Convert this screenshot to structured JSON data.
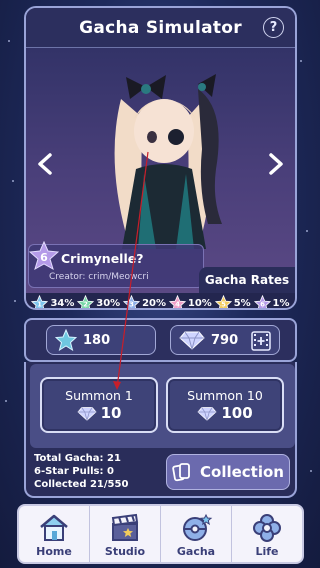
{
  "header": {
    "title": "Gacha Simulator",
    "help_label": "?"
  },
  "character": {
    "name": "Crimynelle?",
    "creator": "Creator: crim/Meowcri",
    "rank": "6"
  },
  "rates": {
    "button_label": "Gacha Rates",
    "items": [
      {
        "rank": "1",
        "value": "34%",
        "color": "#7fc6ee"
      },
      {
        "rank": "2",
        "value": "30%",
        "color": "#7ad8a8"
      },
      {
        "rank": "3",
        "value": "20%",
        "color": "#8fb0e8"
      },
      {
        "rank": "4",
        "value": "10%",
        "color": "#f0a0c8"
      },
      {
        "rank": "5",
        "value": "5%",
        "color": "#f2cc5c"
      },
      {
        "rank": "6",
        "value": "1%",
        "color": "#b49ae8"
      }
    ]
  },
  "currency": {
    "stars": "180",
    "gems": "790"
  },
  "summon": {
    "one": {
      "label": "Summon 1",
      "cost": "10"
    },
    "ten": {
      "label": "Summon 10",
      "cost": "100"
    }
  },
  "stats": {
    "total": "Total Gacha: 21",
    "six_star": "6-Star Pulls: 0",
    "collected": "Collected 21/550"
  },
  "collection_label": "Collection",
  "nav": {
    "home": "Home",
    "studio": "Studio",
    "gacha": "Gacha",
    "life": "Life"
  },
  "colors": {
    "accent": "#9aa4d8",
    "panel": "#2c2f5e",
    "nav_bg": "#f4f3fb"
  }
}
